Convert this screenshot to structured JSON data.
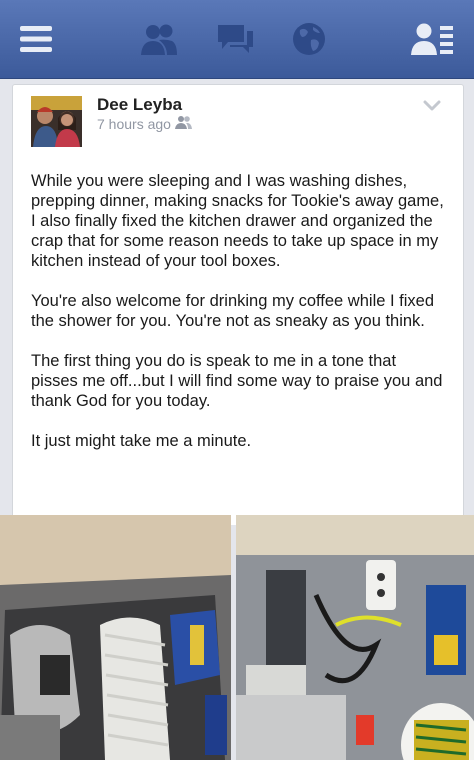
{
  "nav": {
    "menu_icon": "hamburger-menu-icon",
    "friend_requests_icon": "friends-icon",
    "messages_icon": "messages-icon",
    "notifications_icon": "globe-icon",
    "contacts_icon": "contacts-icon",
    "bar_color": "#4a67a8"
  },
  "post": {
    "author": "Dee Leyba",
    "time": "7 hours ago",
    "audience_icon": "friends-audience-icon",
    "options_icon": "chevron-down-icon",
    "paragraphs": [
      "While you were sleeping and I was washing dishes, prepping dinner, making snacks for Tookie's away game, I also finally fixed the kitchen drawer and organized the crap that for some reason needs to take up space in my kitchen instead of your tool boxes.",
      "You're also welcome for drinking my coffee while I fixed the shower for you. You're not as sneaky as you think.",
      "The first thing you do is speak to me in a tone that pisses me off...but I will find some way to praise you and thank God for you today.",
      "It just might take me a minute."
    ]
  }
}
